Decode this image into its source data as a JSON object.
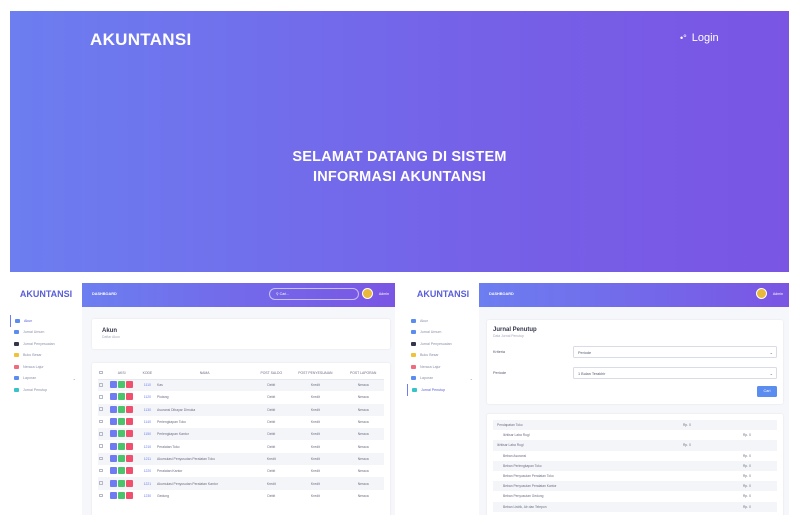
{
  "hero": {
    "brand": "AKUNTANSI",
    "login_label": "Login",
    "title_line1": "SELAMAT DATANG DI SISTEM",
    "title_line2": "INFORMASI AKUNTANSI"
  },
  "sidebar": {
    "brand": "AKUNTANSI",
    "items": [
      {
        "label": "Akun",
        "color": "#5b8cf0"
      },
      {
        "label": "Jurnal Umum",
        "color": "#5b8cf0"
      },
      {
        "label": "Jurnal Penyesuaian",
        "color": "#33364a"
      },
      {
        "label": "Buku Besar",
        "color": "#f0c23b"
      },
      {
        "label": "Neraca Lajur",
        "color": "#f06b7b"
      },
      {
        "label": "Laporan",
        "color": "#5b8cf0"
      },
      {
        "label": "Jurnal Penutup",
        "color": "#38c3c9"
      }
    ]
  },
  "topbar": {
    "title": "DASHBOARD",
    "search_placeholder": "Cari...",
    "user": "Admin"
  },
  "akun_page": {
    "title": "Akun",
    "subtitle": "Daftar Akun",
    "action_colors": [
      "#f0506e",
      "#38b7e8",
      "#6f6fd8",
      "#4cc46b"
    ],
    "columns": [
      "AKSI",
      "KODE",
      "NAMA",
      "POST SALDO",
      "POST PENYESUAIAN",
      "POST LAPORAN"
    ],
    "rows": [
      {
        "kode": "1110",
        "nama": "Kas",
        "saldo": "Debit",
        "penyesuaian": "Kredit",
        "laporan": "Neraca"
      },
      {
        "kode": "1120",
        "nama": "Piutang",
        "saldo": "Debit",
        "penyesuaian": "Kredit",
        "laporan": "Neraca"
      },
      {
        "kode": "1130",
        "nama": "Asuransi Dibayar Dimuka",
        "saldo": "Debit",
        "penyesuaian": "Kredit",
        "laporan": "Neraca"
      },
      {
        "kode": "1140",
        "nama": "Perlengkapan Toko",
        "saldo": "Debit",
        "penyesuaian": "Kredit",
        "laporan": "Neraca"
      },
      {
        "kode": "1150",
        "nama": "Perlengkapan Kantor",
        "saldo": "Debit",
        "penyesuaian": "Kredit",
        "laporan": "Neraca"
      },
      {
        "kode": "1210",
        "nama": "Peralatan Toko",
        "saldo": "Debit",
        "penyesuaian": "Kredit",
        "laporan": "Neraca"
      },
      {
        "kode": "1211",
        "nama": "Akumulasi Penyusutan Peralatan Toko",
        "saldo": "Kredit",
        "penyesuaian": "Kredit",
        "laporan": "Neraca"
      },
      {
        "kode": "1220",
        "nama": "Peralatan Kantor",
        "saldo": "Debit",
        "penyesuaian": "Kredit",
        "laporan": "Neraca"
      },
      {
        "kode": "1221",
        "nama": "Akumulasi Penyusutan Peralatan Kantor",
        "saldo": "Kredit",
        "penyesuaian": "Kredit",
        "laporan": "Neraca"
      },
      {
        "kode": "1230",
        "nama": "Gedung",
        "saldo": "Debit",
        "penyesuaian": "Kredit",
        "laporan": "Neraca"
      }
    ]
  },
  "penutup_page": {
    "title": "Jurnal Penutup",
    "subtitle": "Data Jurnal Penutup",
    "kriteria_label": "Kriteria",
    "kriteria_value": "Periode",
    "periode_label": "Periode",
    "periode_value": "1 Bulan Terakhir",
    "cari_label": "Cari",
    "rows": [
      {
        "name": "Pendapatan Toko",
        "c1": "Rp. 0",
        "c2": ""
      },
      {
        "name": "Ikhtisar Laba Rugi",
        "c1": "",
        "c2": "Rp. 0"
      },
      {
        "name": "Ikhtisar Laba Rugi",
        "c1": "Rp. 0",
        "c2": ""
      },
      {
        "name": "Beban Asuransi",
        "c1": "",
        "c2": "Rp. 0"
      },
      {
        "name": "Beban Perlengkapan Toko",
        "c1": "",
        "c2": "Rp. 0"
      },
      {
        "name": "Beban Penyusutan Peralatan Toko",
        "c1": "",
        "c2": "Rp. 0"
      },
      {
        "name": "Beban Penyusutan Peralatan Kantor",
        "c1": "",
        "c2": "Rp. 0"
      },
      {
        "name": "Beban Penyusutan Gedung",
        "c1": "",
        "c2": "Rp. 0"
      },
      {
        "name": "Beban Listrik, Air dan Telepon",
        "c1": "",
        "c2": "Rp. 0"
      }
    ]
  }
}
